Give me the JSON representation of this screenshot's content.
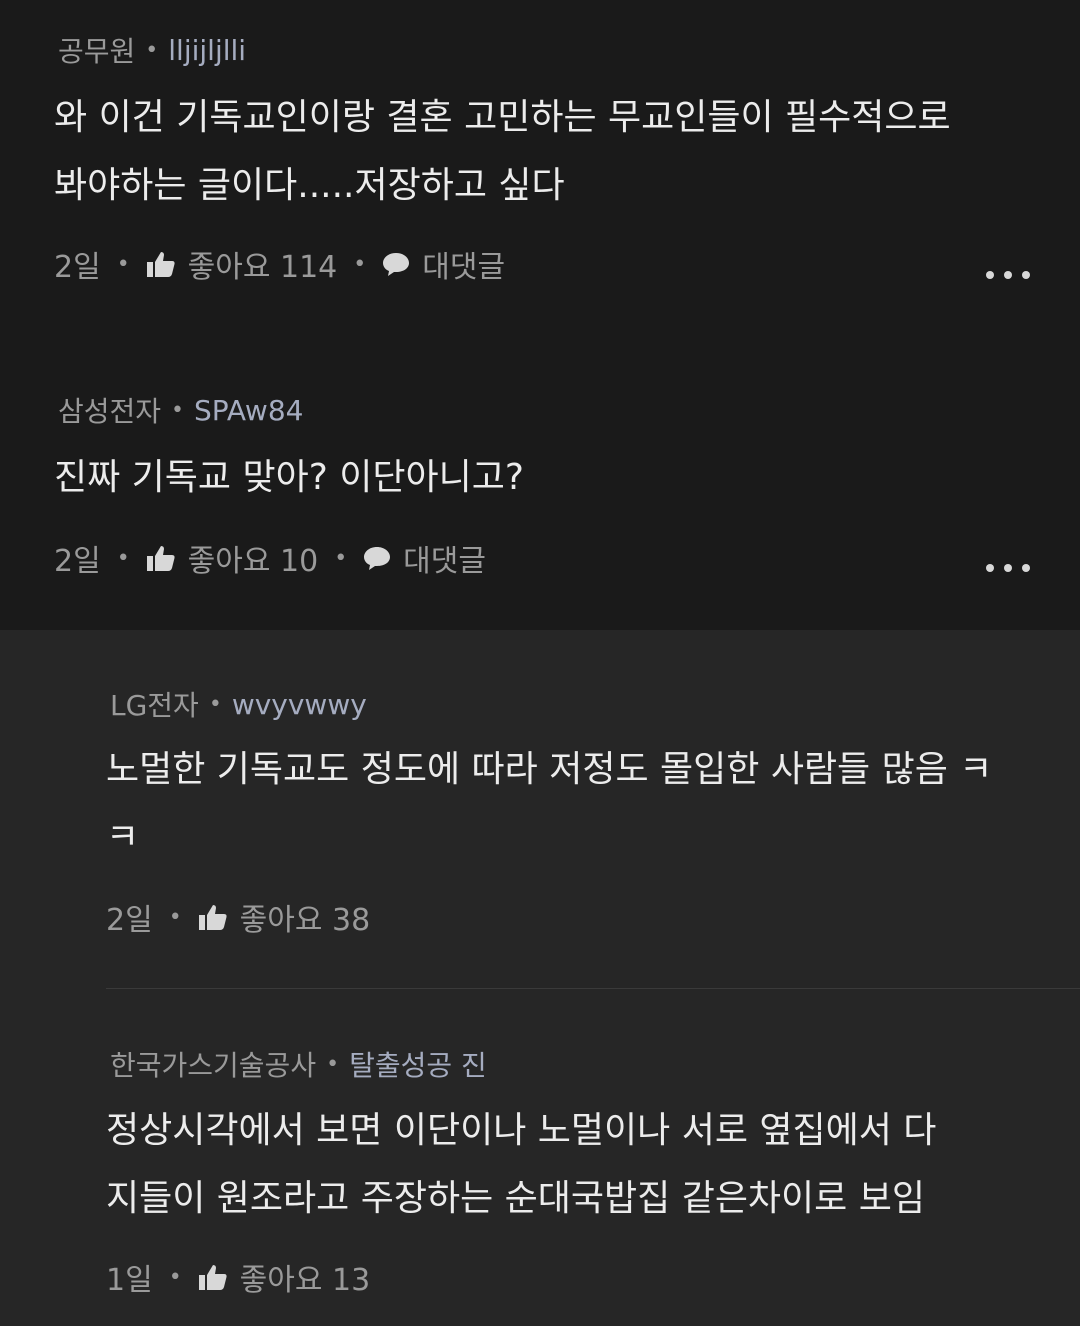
{
  "comments": [
    {
      "company": "공무원",
      "nickname": "lljijljlli",
      "text_lines": [
        "와 이건 기독교인이랑 결혼 고민하는 무교인들이 필수적으로",
        "봐야하는 글이다.....저장하고 싶다"
      ],
      "time": "2일",
      "like_label": "좋아요 114",
      "reply_label": "대댓글"
    },
    {
      "company": "삼성전자",
      "nickname": "SPAw84",
      "text_lines": [
        "진짜 기독교 맞아? 이단아니고?"
      ],
      "time": "2일",
      "like_label": "좋아요 10",
      "reply_label": "대댓글"
    }
  ],
  "replies": [
    {
      "company": "LG전자",
      "nickname": "wvyvwwy",
      "text_lines": [
        "노멀한 기독교도 정도에 따라 저정도 몰입한 사람들 많음 ㅋ",
        "ㅋ"
      ],
      "time": "2일",
      "like_label": "좋아요 38"
    },
    {
      "company": "한국가스기술공사",
      "nickname": "탈출성공 진",
      "text_lines": [
        "정상시각에서 보면 이단이나 노멀이나 서로 옆집에서 다",
        "지들이 원조라고 주장하는 순대국밥집 같은차이로 보임"
      ],
      "time": "1일",
      "like_label": "좋아요 13"
    }
  ],
  "icons": {
    "like": "thumbs-up-icon",
    "reply": "speech-bubble-icon",
    "more": "more-dots-icon"
  },
  "colors": {
    "background": "#1a1a1a",
    "reply_background": "#262626",
    "text": "#ececec",
    "muted": "#9a9a9a",
    "nickname": "#a5acc0"
  }
}
